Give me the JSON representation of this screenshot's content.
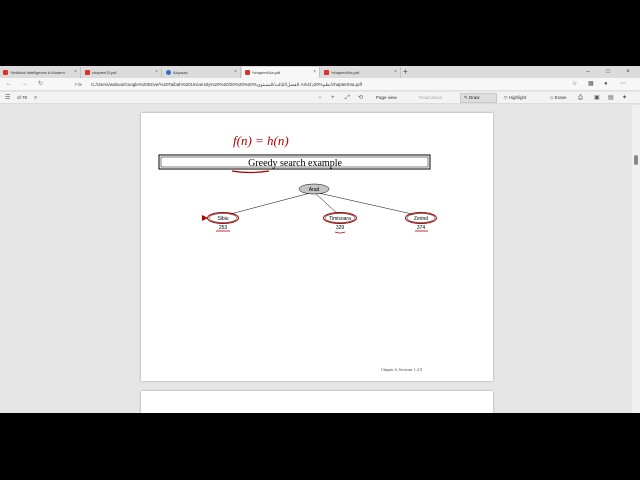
{
  "tabs": [
    {
      "label": "*Artificial Intelligence A Modern",
      "active": false
    },
    {
      "label": "chapter03.pdf",
      "active": false
    },
    {
      "label": "Alquaza",
      "active": false
    },
    {
      "label": "*chapter04a.pdf",
      "active": true
    },
    {
      "label": "*chapter04a.pdf",
      "active": false
    }
  ],
  "address_bar": {
    "file_label": "File",
    "url": "C:/Users/wabua/Google%20Drive/%20Taibah%20University%20%20/الفصل/الثالث/المستوى%20%20%20 AI/نظم%20ذكاء/chapter04a.pdf"
  },
  "pdf_toolbar": {
    "page_number": "of 78",
    "page_view_label": "Page view",
    "read_aloud_label": "Read aloud",
    "draw_label": "Draw",
    "highlight_label": "Highlight",
    "erase_label": "Erase"
  },
  "slide": {
    "title": "Greedy search example",
    "annotation": "f(n) = h(n)",
    "root_node": "Arad",
    "children": [
      {
        "label": "Sibiu",
        "value": "253"
      },
      {
        "label": "Timisoara",
        "value": "329"
      },
      {
        "label": "Zerind",
        "value": "374"
      }
    ],
    "footer": "Chapter 4, Sections 1–2     8"
  },
  "icons": {
    "tab_close": "×",
    "new_tab": "+",
    "back": "←",
    "forward": "→",
    "refresh": "↻",
    "search": "⌕",
    "zoom_out": "−",
    "zoom_in": "+",
    "fit": "⤢",
    "rotate": "⟲",
    "minimize": "–",
    "maximize": "□",
    "close": "×"
  },
  "colors": {
    "ink_red": "#b30000",
    "node_fill": "#c4c4c4",
    "accent": "#d9342b"
  }
}
